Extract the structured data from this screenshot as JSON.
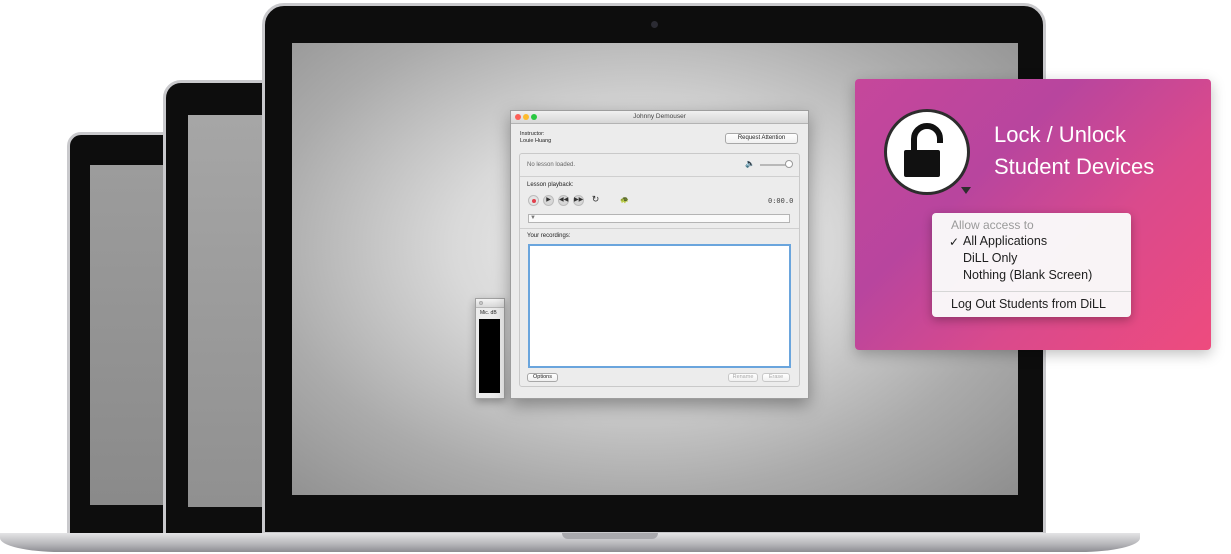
{
  "app_window": {
    "title": "Johnny Demouser",
    "instructor_label": "Instructor:",
    "instructor_name": "Louie Huang",
    "request_attention": "Request Attention",
    "lesson_status": "No lesson loaded.",
    "lesson_playback_label": "Lesson playback:",
    "timer": "0:00.0",
    "recordings_label": "Your recordings:",
    "options_button": "Options",
    "rename_button": "Rename",
    "erase_button": "Erase"
  },
  "mic_meter": {
    "label": "Mic. dB"
  },
  "callout": {
    "title_line1": "Lock / Unlock",
    "title_line2": "Student Devices",
    "menu": {
      "header": "Allow access to",
      "checkmark": "✓",
      "items": [
        "All Applications",
        "DiLL Only",
        "Nothing (Blank Screen)"
      ],
      "selected": "All Applications",
      "logout": "Log Out Students from DiLL"
    }
  },
  "colors": {
    "card_gradient_start": "#c6479b",
    "card_gradient_end": "#ee4b7e",
    "record_red": "#e2414d",
    "focus_blue": "#6aa5dd"
  },
  "icons": [
    "unlocked-padlock-icon",
    "volume-icon",
    "record-icon",
    "play-icon",
    "rewind-icon",
    "fast-forward-icon",
    "repeat-icon",
    "turtle-slow-icon"
  ]
}
